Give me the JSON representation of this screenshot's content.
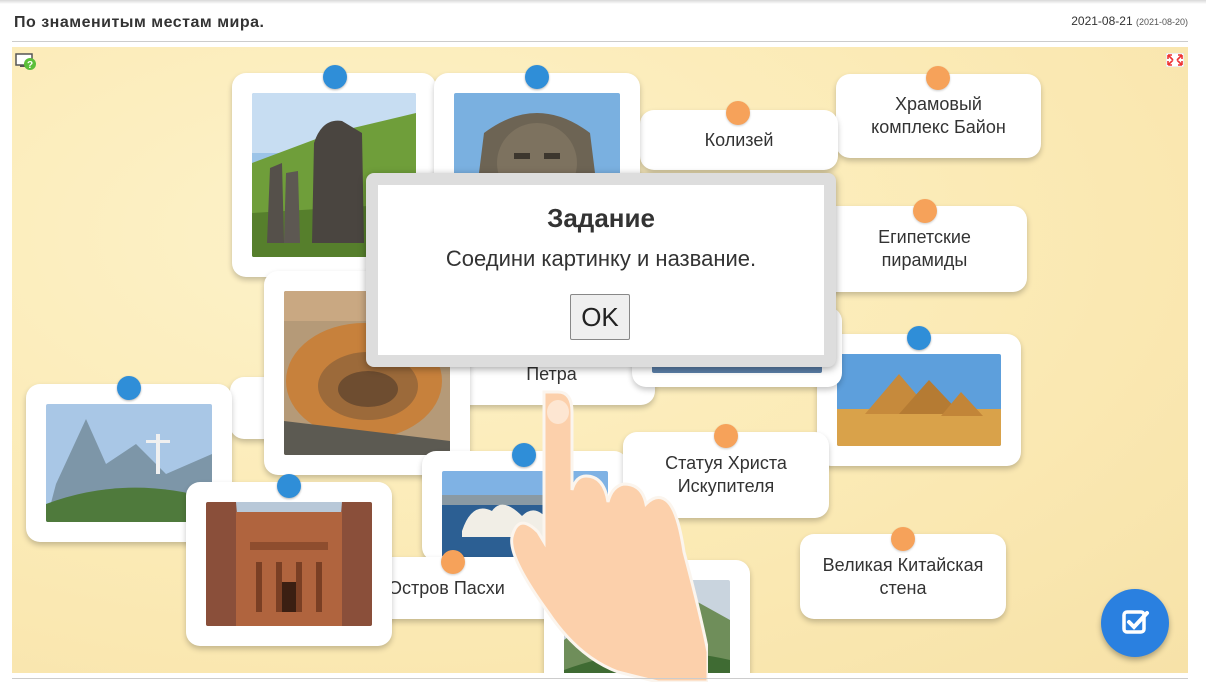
{
  "header": {
    "title": "По знаменитым местам мира.",
    "date": "2021-08-21",
    "date_small": "(2021-08-20)"
  },
  "labels": {
    "colosseum": "Колизей",
    "bayon": "Храмовый комплекс Байон",
    "pyramids": "Египетские пирамиды",
    "petra": "Петра",
    "christ": "Статуя Христа Искупителя",
    "wall": "Великая Китайская стена",
    "easter": "Остров Пасхи"
  },
  "modal": {
    "title": "Задание",
    "text": "Соедини картинку и название.",
    "ok": "OK"
  },
  "icons": {
    "help": "help-icon",
    "fullscreen": "fullscreen-icon",
    "check": "check-icon",
    "hand": "pointing-hand-icon"
  },
  "colors": {
    "board": "#fbeab5",
    "pin_blue": "#2f8ed8",
    "pin_orange": "#f6a25a",
    "check_button": "#2a80e0"
  }
}
